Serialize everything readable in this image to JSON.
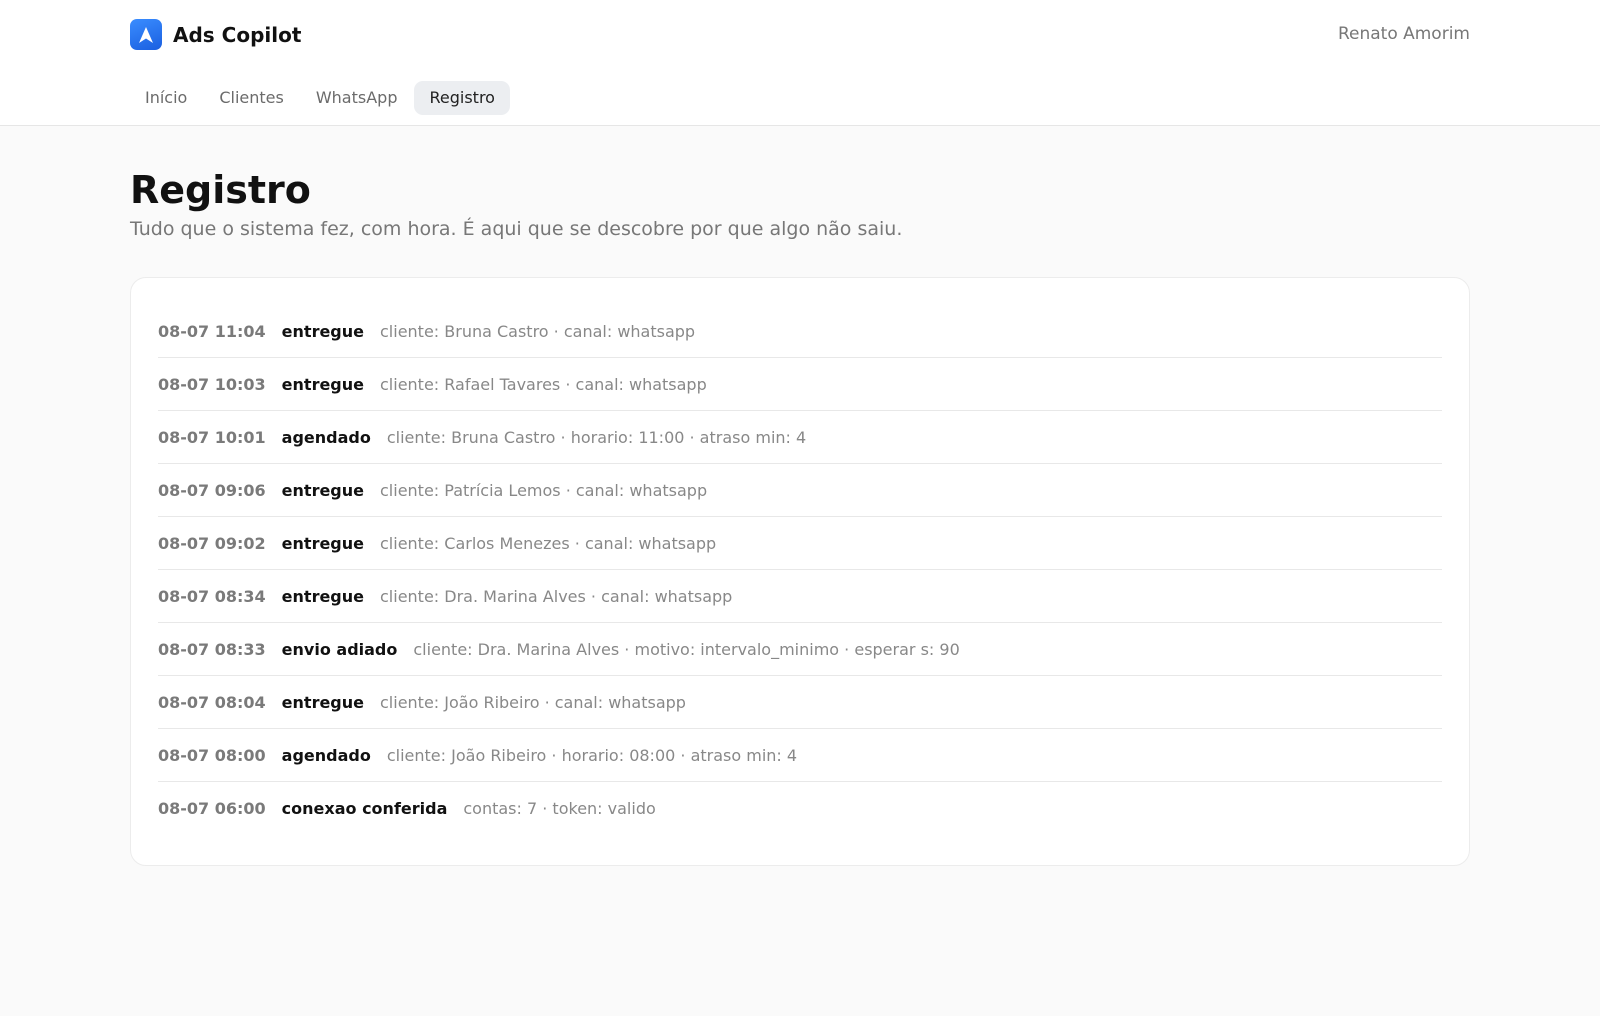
{
  "app": {
    "name": "Ads Copilot",
    "logo_icon": "arrow-up-icon",
    "accent_color": "#1f6fea"
  },
  "user": {
    "name": "Renato Amorim"
  },
  "nav": {
    "tabs": [
      {
        "label": "Início",
        "active": false
      },
      {
        "label": "Clientes",
        "active": false
      },
      {
        "label": "WhatsApp",
        "active": false
      },
      {
        "label": "Registro",
        "active": true
      }
    ]
  },
  "page": {
    "title": "Registro",
    "subtitle": "Tudo que o sistema fez, com hora. É aqui que se descobre por que algo não saiu."
  },
  "log": {
    "entries": [
      {
        "time": "08-07 11:04",
        "event": "entregue",
        "details": "cliente: Bruna Castro · canal: whatsapp"
      },
      {
        "time": "08-07 10:03",
        "event": "entregue",
        "details": "cliente: Rafael Tavares · canal: whatsapp"
      },
      {
        "time": "08-07 10:01",
        "event": "agendado",
        "details": "cliente: Bruna Castro · horario: 11:00 · atraso min: 4"
      },
      {
        "time": "08-07 09:06",
        "event": "entregue",
        "details": "cliente: Patrícia Lemos · canal: whatsapp"
      },
      {
        "time": "08-07 09:02",
        "event": "entregue",
        "details": "cliente: Carlos Menezes · canal: whatsapp"
      },
      {
        "time": "08-07 08:34",
        "event": "entregue",
        "details": "cliente: Dra. Marina Alves · canal: whatsapp"
      },
      {
        "time": "08-07 08:33",
        "event": "envio adiado",
        "details": "cliente: Dra. Marina Alves · motivo: intervalo_minimo · esperar s: 90"
      },
      {
        "time": "08-07 08:04",
        "event": "entregue",
        "details": "cliente: João Ribeiro · canal: whatsapp"
      },
      {
        "time": "08-07 08:00",
        "event": "agendado",
        "details": "cliente: João Ribeiro · horario: 08:00 · atraso min: 4"
      },
      {
        "time": "08-07 06:00",
        "event": "conexao conferida",
        "details": "contas: 7 · token: valido"
      }
    ]
  }
}
